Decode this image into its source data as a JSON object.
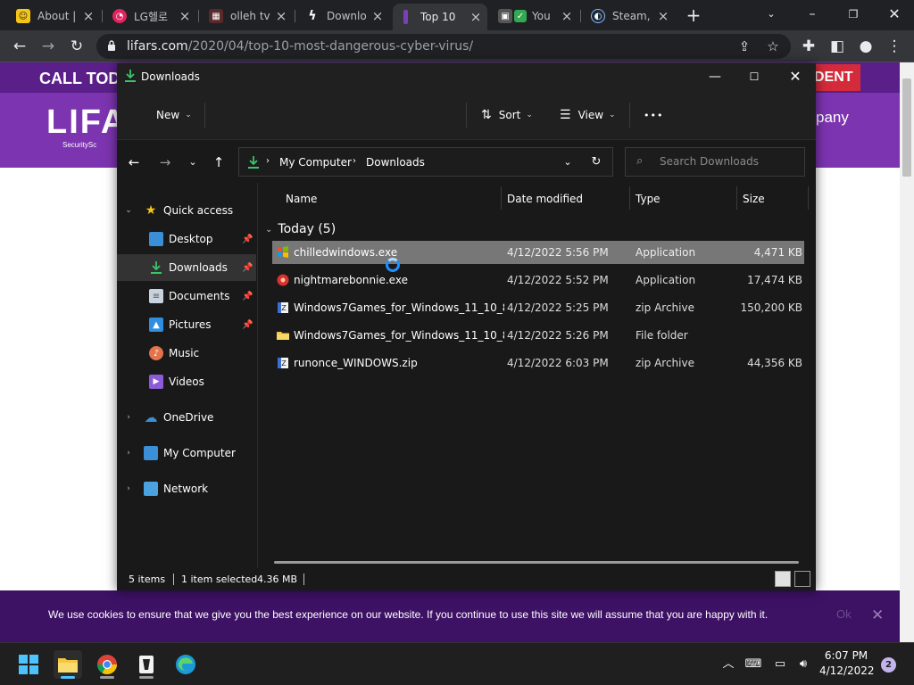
{
  "browser": {
    "tabs": [
      {
        "title": "About |",
        "icon": "about-favicon",
        "color": "#f5c518"
      },
      {
        "title": "LG헬로",
        "icon": "lg-hello-favicon",
        "color": "#e0245e"
      },
      {
        "title": "olleh tv",
        "icon": "olleh-favicon",
        "color": "#c62828"
      },
      {
        "title": "Downlo",
        "icon": "bolt-favicon",
        "color": "#ffffff"
      },
      {
        "title": "Top 10",
        "icon": "top10-favicon",
        "color": "#7b3fb5"
      },
      {
        "title": "You",
        "icon": "youtube-favicon",
        "color": "#34a853"
      },
      {
        "title": "Steam,",
        "icon": "steam-favicon",
        "color": "#1b2838"
      }
    ],
    "url_host": "lifars.com",
    "url_path": "/2020/04/top-10-most-dangerous-cyber-virus/"
  },
  "site": {
    "call_text": "CALL TOD",
    "incident_text": "DENT",
    "logo_text": "LIFA",
    "logo_sub": "SecuritySc",
    "company_text": "pany",
    "cookie_text": "We use cookies to ensure that we give you the best experience on our website. If you continue to use this site we will assume that you are happy with it.",
    "cookie_ok": "Ok",
    "cookie_close": "✕"
  },
  "explorer": {
    "title": "Downloads",
    "commands": {
      "new": "New",
      "sort": "Sort",
      "view": "View",
      "more": "•••"
    },
    "breadcrumb": [
      "My Computer",
      "Downloads"
    ],
    "search_placeholder": "Search Downloads",
    "nav": [
      {
        "label": "Quick access",
        "icon": "star-icon",
        "level": 0,
        "expanded": true
      },
      {
        "label": "Desktop",
        "icon": "desktop-icon",
        "level": 1,
        "pinned": true
      },
      {
        "label": "Downloads",
        "icon": "download-icon",
        "level": 1,
        "pinned": true,
        "selected": true
      },
      {
        "label": "Documents",
        "icon": "documents-icon",
        "level": 1,
        "pinned": true
      },
      {
        "label": "Pictures",
        "icon": "pictures-icon",
        "level": 1,
        "pinned": true
      },
      {
        "label": "Music",
        "icon": "music-icon",
        "level": 1
      },
      {
        "label": "Videos",
        "icon": "videos-icon",
        "level": 1
      },
      {
        "label": "OneDrive",
        "icon": "cloud-icon",
        "level": 0,
        "expanded": false
      },
      {
        "label": "My Computer",
        "icon": "computer-icon",
        "level": 0,
        "expanded": false
      },
      {
        "label": "Network",
        "icon": "network-icon",
        "level": 0,
        "expanded": false
      }
    ],
    "columns": {
      "name": "Name",
      "date": "Date modified",
      "type": "Type",
      "size": "Size"
    },
    "group_label": "Today (5)",
    "files": [
      {
        "name": "chilledwindows.exe",
        "date": "4/12/2022 5:56 PM",
        "type": "Application",
        "size": "4,471 KB",
        "icon": "windows-app-icon",
        "selected": true
      },
      {
        "name": "nightmarebonnie.exe",
        "date": "4/12/2022 5:52 PM",
        "type": "Application",
        "size": "17,474 KB",
        "icon": "red-app-icon"
      },
      {
        "name": "Windows7Games_for_Windows_11_10_8....",
        "date": "4/12/2022 5:25 PM",
        "type": "zip Archive",
        "size": "150,200 KB",
        "icon": "zip-icon"
      },
      {
        "name": "Windows7Games_for_Windows_11_10_8",
        "date": "4/12/2022 5:26 PM",
        "type": "File folder",
        "size": "",
        "icon": "folder-icon"
      },
      {
        "name": "runonce_WINDOWS.zip",
        "date": "4/12/2022 6:03 PM",
        "type": "zip Archive",
        "size": "44,356 KB",
        "icon": "zip-icon"
      }
    ],
    "status": {
      "items": "5 items",
      "selected": "1 item selected",
      "size": "4.36 MB"
    }
  },
  "taskbar": {
    "time": "6:07 PM",
    "date": "4/12/2022",
    "notifications": "2"
  },
  "colors": {
    "site_purple": "#7c34b0",
    "site_dark_purple": "#5b1f8a",
    "cookie_bar": "#3d1164",
    "explorer_bg": "#191919",
    "selection": "#777777"
  }
}
